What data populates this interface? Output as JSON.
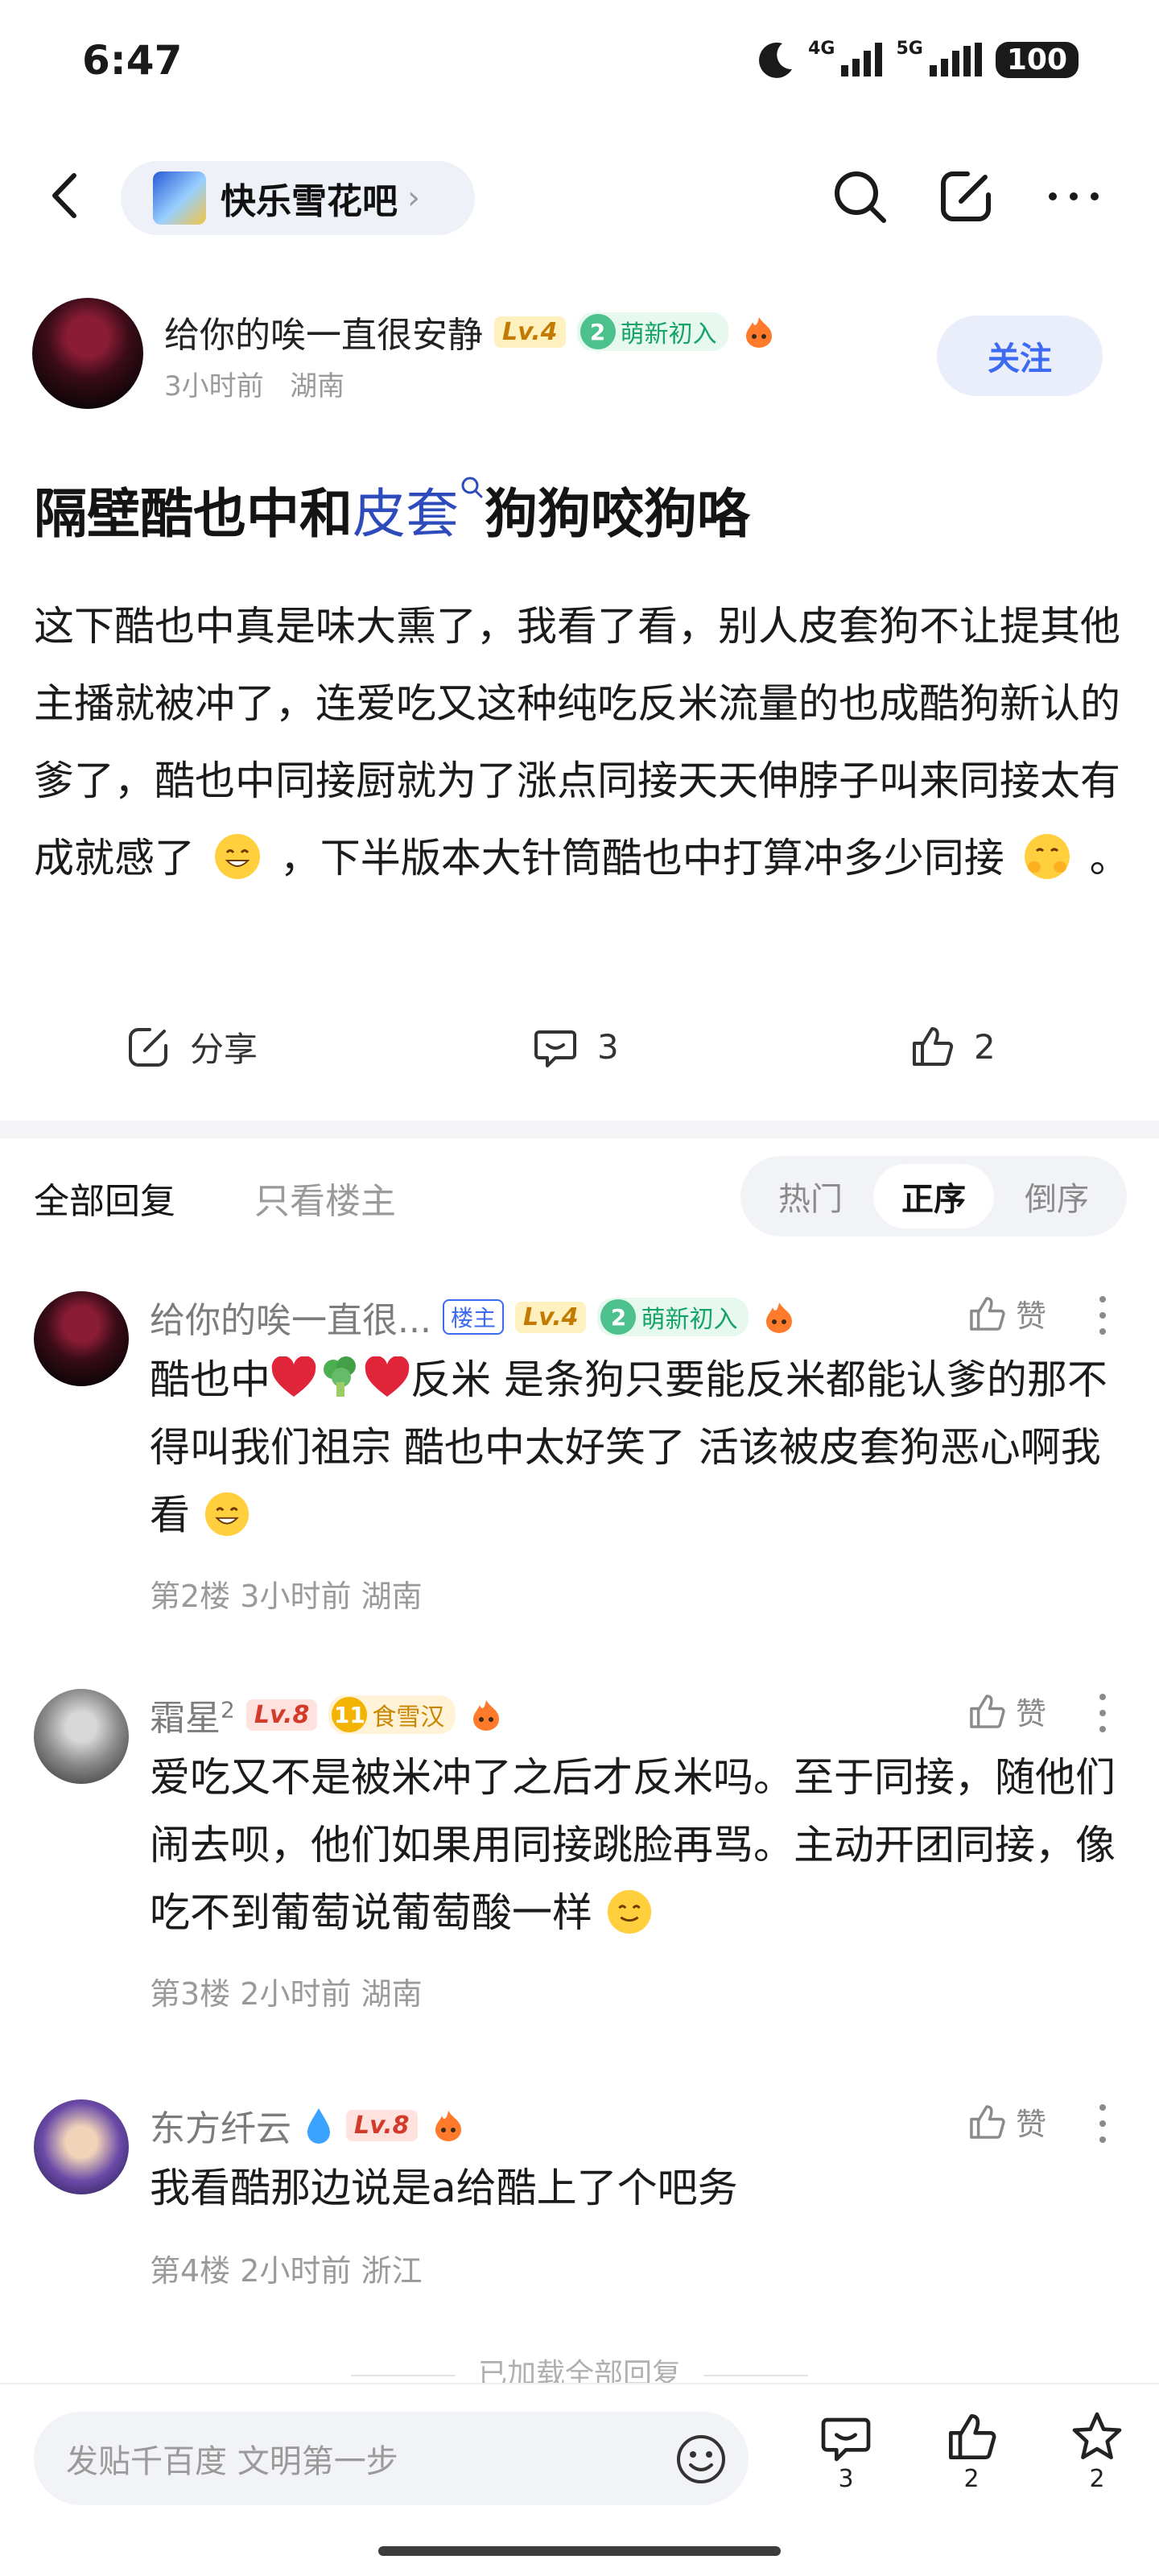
{
  "status_bar": {
    "time": "6:47",
    "network_1": "4G",
    "network_2": "5G",
    "battery": "100"
  },
  "nav": {
    "forum_name": "快乐雪花吧",
    "icons": [
      "back-icon",
      "search-icon",
      "edit-share-icon",
      "more-icon"
    ]
  },
  "post": {
    "author": {
      "name": "给你的唉一直很安静",
      "level": "Lv.4",
      "badge_num": "2",
      "badge_text": "萌新初入"
    },
    "meta": {
      "time": "3小时前",
      "location": "湖南"
    },
    "follow_label": "关注",
    "title_prefix": "隔壁酷也中和",
    "title_link": "皮套",
    "title_suffix": "狗狗咬狗咯",
    "body_part1": "这下酷也中真是味大熏了，我看了看，别人皮套狗不让提其他主播就被冲了，连爱吃又这种纯吃反米流量的也成酷狗新认的爹了，酷也中同接厨就为了涨点同接天天伸脖子叫来同接太有成就感了",
    "body_part2": "，下半版本大针筒酷也中打算冲多少同接",
    "body_part3": "。"
  },
  "actions": {
    "share_label": "分享",
    "comment_count": "3",
    "like_count": "2"
  },
  "reply_tabs": {
    "all": "全部回复",
    "op_only": "只看楼主",
    "sort": [
      "热门",
      "正序",
      "倒序"
    ],
    "sort_active": "正序"
  },
  "replies": [
    {
      "name": "给你的唉一直很...",
      "tag": "楼主",
      "level": "Lv.4",
      "badge_num": "2",
      "badge_text": "萌新初入",
      "like_label": "赞",
      "text_a": "酷也中",
      "text_b": "反米 是条狗只要能反米都能认爹的那不得叫我们祖宗 酷也中太好笑了 活该被皮套狗恶心啊我看",
      "floor": "第2楼",
      "time": "3小时前",
      "location": "湖南"
    },
    {
      "name": "霜星",
      "sup": "2",
      "level": "Lv.8",
      "badge_num": "11",
      "badge_text": "食雪汉",
      "like_label": "赞",
      "text": "爱吃又不是被米冲了之后才反米吗。至于同接，随他们闹去呗，他们如果用同接跳脸再骂。主动开团同接，像吃不到葡萄说葡萄酸一样",
      "floor": "第3楼",
      "time": "2小时前",
      "location": "湖南"
    },
    {
      "name": "东方纤云",
      "level": "Lv.8",
      "like_label": "赞",
      "text": "我看酷那边说是a给酷上了个吧务",
      "floor": "第4楼",
      "time": "2小时前",
      "location": "浙江"
    }
  ],
  "loaded_all_label": "已加载全部回复",
  "bottom_bar": {
    "placeholder": "发贴千百度 文明第一步",
    "comment_count": "3",
    "like_count": "2",
    "fav_count": "2"
  },
  "colors": {
    "accent_blue": "#3d6af2",
    "link_blue": "#2d4bbb",
    "follow_bg": "#eaeefb",
    "level4": "#c27b00",
    "level8": "#d23b2a"
  }
}
